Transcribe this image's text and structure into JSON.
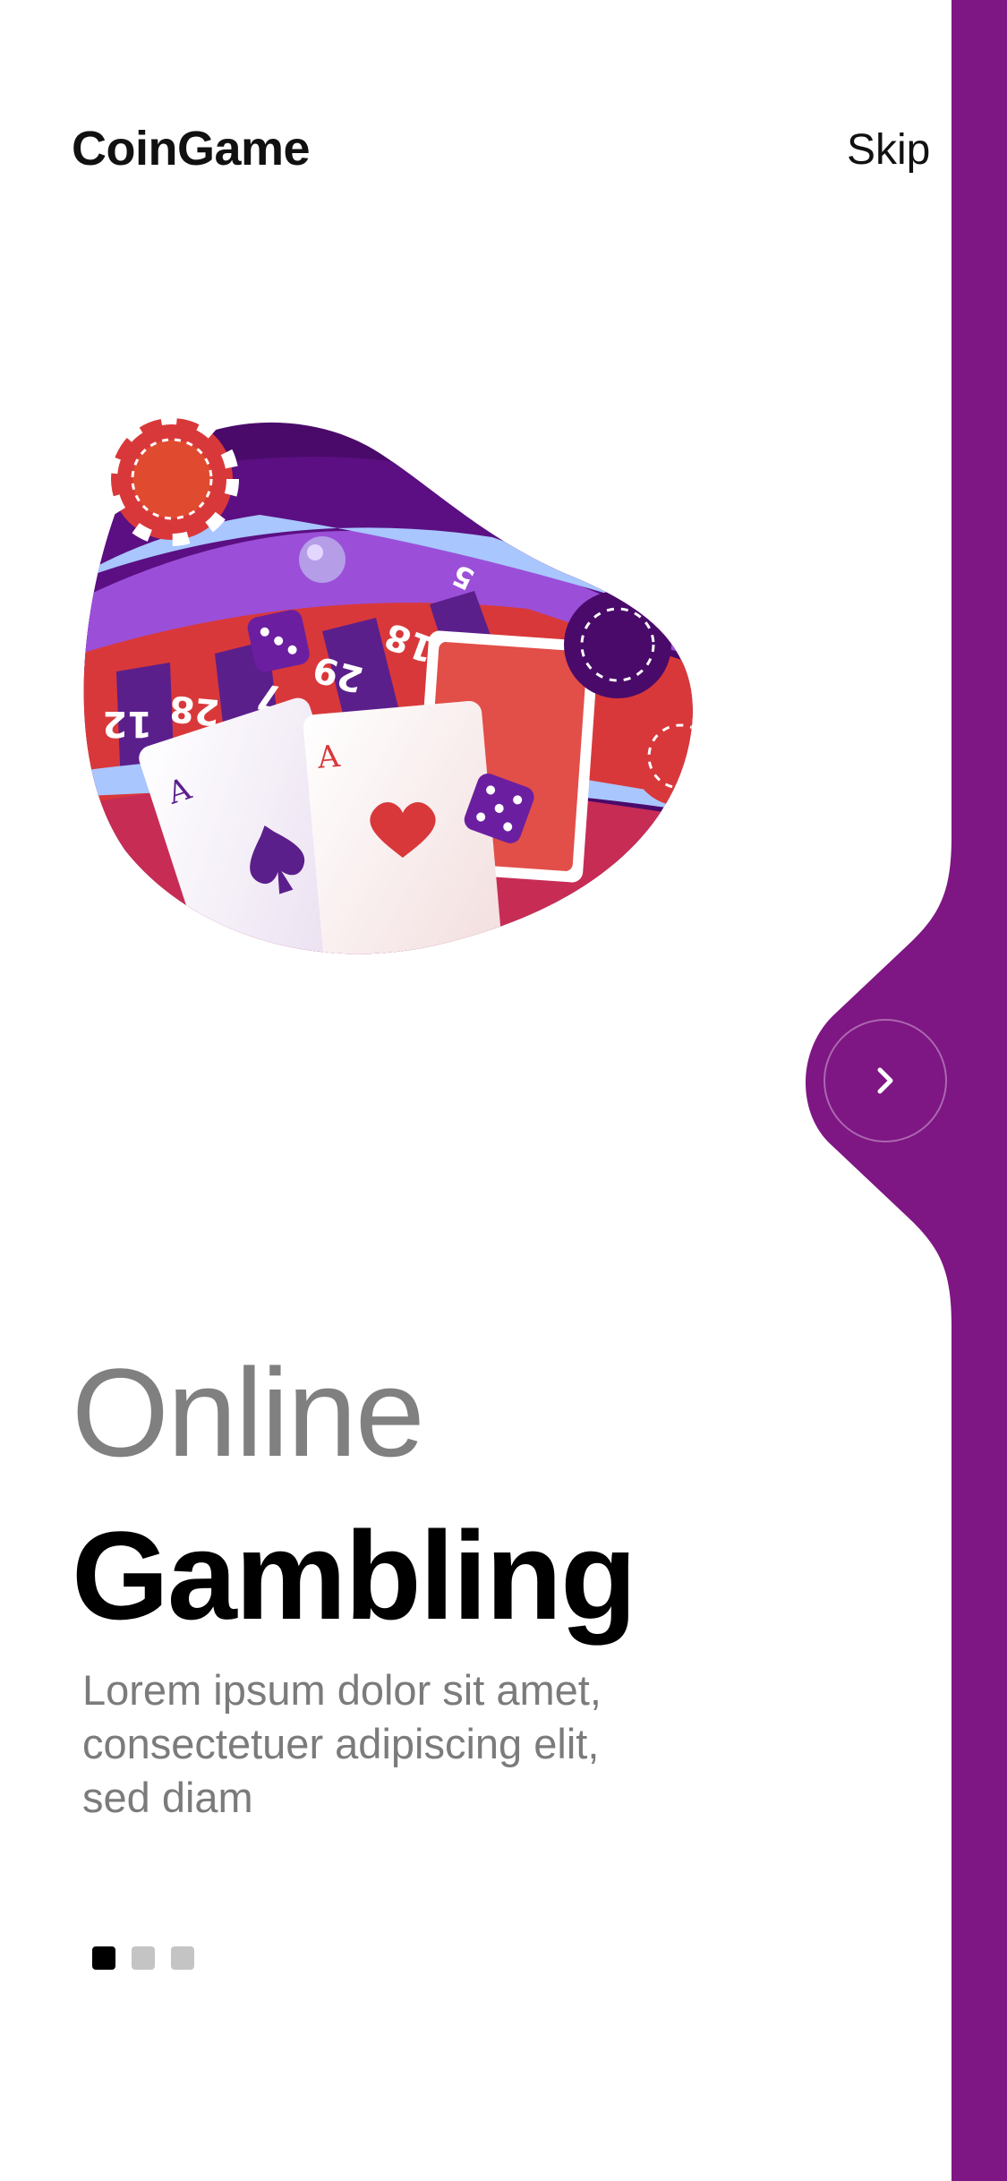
{
  "header": {
    "brand": "CoinGame",
    "skip_label": "Skip"
  },
  "illustration": {
    "roulette_numbers": [
      "12",
      "28",
      "7",
      "29",
      "18",
      "5"
    ],
    "card_rank": "A"
  },
  "next_button": {
    "icon": "chevron-right-icon"
  },
  "hero": {
    "title_light": "Online",
    "title_bold": "Gambling",
    "description": "Lorem ipsum dolor sit amet, consectetuer adipiscing elit, sed diam"
  },
  "pagination": {
    "pages": 3,
    "current": 1
  },
  "colors": {
    "accent": "#7e1684",
    "text_dark": "#111111",
    "text_muted": "#808080",
    "dot_inactive": "#c4c4c4"
  }
}
